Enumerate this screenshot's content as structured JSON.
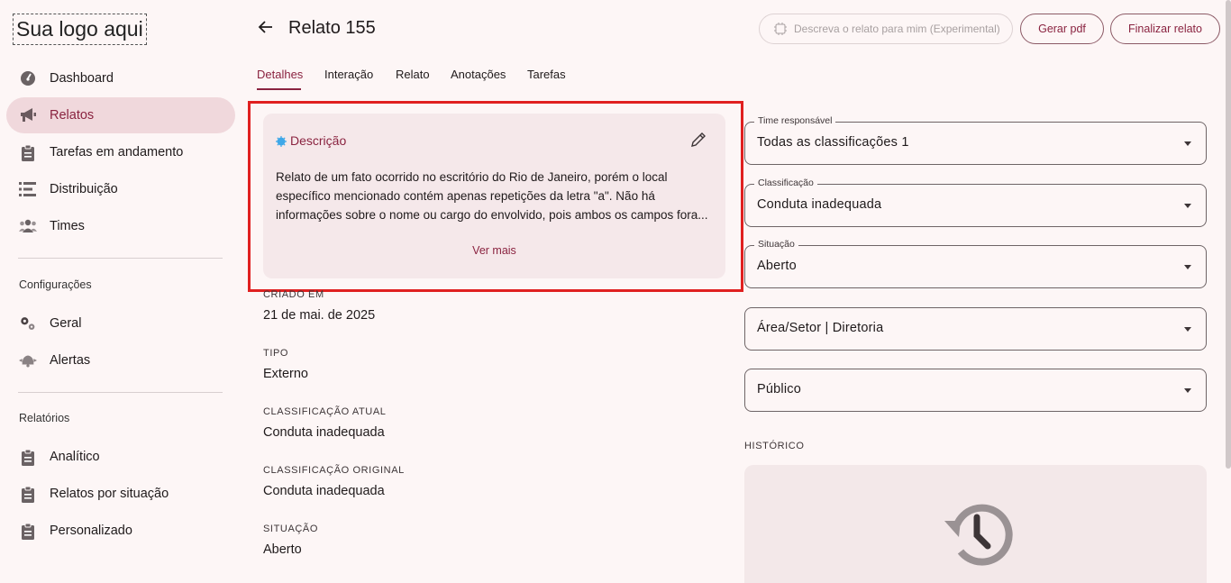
{
  "logo": "Sua logo aqui",
  "sidebar": {
    "items": [
      {
        "label": "Dashboard",
        "icon": "dashboard-icon"
      },
      {
        "label": "Relatos",
        "icon": "megaphone-icon",
        "active": true
      },
      {
        "label": "Tarefas em andamento",
        "icon": "clipboard-icon"
      },
      {
        "label": "Distribuição",
        "icon": "list-icon"
      },
      {
        "label": "Times",
        "icon": "people-icon"
      }
    ],
    "config_title": "Configurações",
    "config_items": [
      {
        "label": "Geral",
        "icon": "gears-icon"
      },
      {
        "label": "Alertas",
        "icon": "alert-icon"
      }
    ],
    "reports_title": "Relatórios",
    "report_items": [
      {
        "label": "Analítico",
        "icon": "clipboard-icon"
      },
      {
        "label": "Relatos por situação",
        "icon": "clipboard-icon"
      },
      {
        "label": "Personalizado",
        "icon": "clipboard-icon"
      }
    ]
  },
  "header": {
    "title": "Relato 155",
    "ai_button": "Descreva o relato para mim (Experimental)",
    "pdf_button": "Gerar pdf",
    "finish_button": "Finalizar relato"
  },
  "tabs": [
    "Detalhes",
    "Interação",
    "Relato",
    "Anotações",
    "Tarefas"
  ],
  "description": {
    "title": "Descrição",
    "text": "Relato de um fato ocorrido no escritório do Rio de Janeiro, porém o local específico mencionado contém apenas repetições da letra \"a\". Não há informações sobre o nome ou cargo do envolvido, pois ambos os campos fora...",
    "more": "Ver mais"
  },
  "details": [
    {
      "label": "CRIADO EM",
      "value": "21 de mai. de 2025"
    },
    {
      "label": "TIPO",
      "value": "Externo"
    },
    {
      "label": "CLASSIFICAÇÃO ATUAL",
      "value": "Conduta inadequada"
    },
    {
      "label": "CLASSIFICAÇÃO ORIGINAL",
      "value": "Conduta inadequada"
    },
    {
      "label": "SITUAÇÃO",
      "value": "Aberto"
    }
  ],
  "form": [
    {
      "label": "Time responsável",
      "value": "Todas as classificações 1"
    },
    {
      "label": "Classificação",
      "value": "Conduta inadequada"
    },
    {
      "label": "Situação",
      "value": "Aberto"
    },
    {
      "label": "",
      "value": "Área/Setor | Diretoria"
    },
    {
      "label": "",
      "value": "Público"
    }
  ],
  "history_title": "HISTÓRICO",
  "colors": {
    "accent": "#8a2340",
    "active_bg": "#f0d8dc",
    "highlight": "#e02020",
    "background": "#fdf6f6"
  }
}
